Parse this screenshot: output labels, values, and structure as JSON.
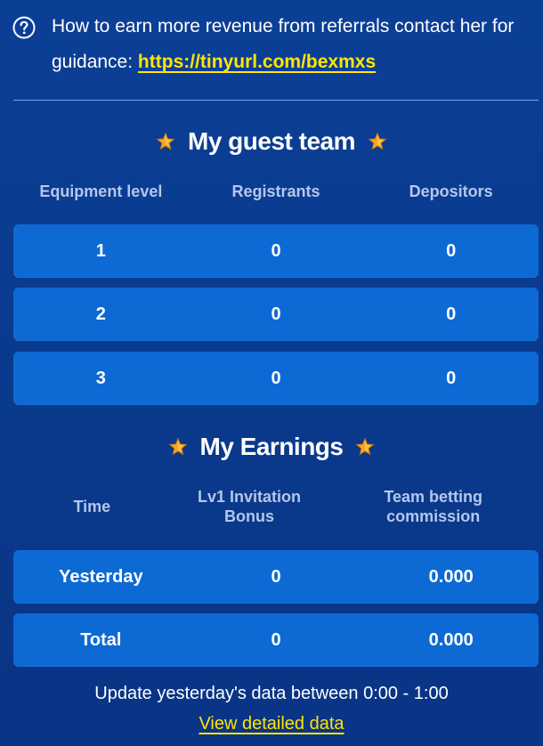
{
  "info": {
    "text": "How to earn more revenue from referrals contact her for guidance: ",
    "link": "https://tinyurl.com/bexmxs",
    "icon": "help-circle-icon"
  },
  "guest_team": {
    "title": "My guest team",
    "headers": [
      "Equipment level",
      "Registrants",
      "Depositors"
    ],
    "rows": [
      [
        "1",
        "0",
        "0"
      ],
      [
        "2",
        "0",
        "0"
      ],
      [
        "3",
        "0",
        "0"
      ]
    ]
  },
  "earnings": {
    "title": "My Earnings",
    "headers": [
      "Time",
      "Lv1 Invitation Bonus",
      "Team betting commission"
    ],
    "rows": [
      [
        "Yesterday",
        "0",
        "0.000"
      ],
      [
        "Total",
        "0",
        "0.000"
      ]
    ]
  },
  "footer": {
    "note": "Update yesterday's data between 0:00 - 1:00",
    "link": "View detailed data"
  },
  "colors": {
    "background": "#0a3a8d",
    "row": "#0d6ad4",
    "accent": "#ffe600",
    "header_text": "#b4c7ec",
    "star": "#f5a623"
  }
}
